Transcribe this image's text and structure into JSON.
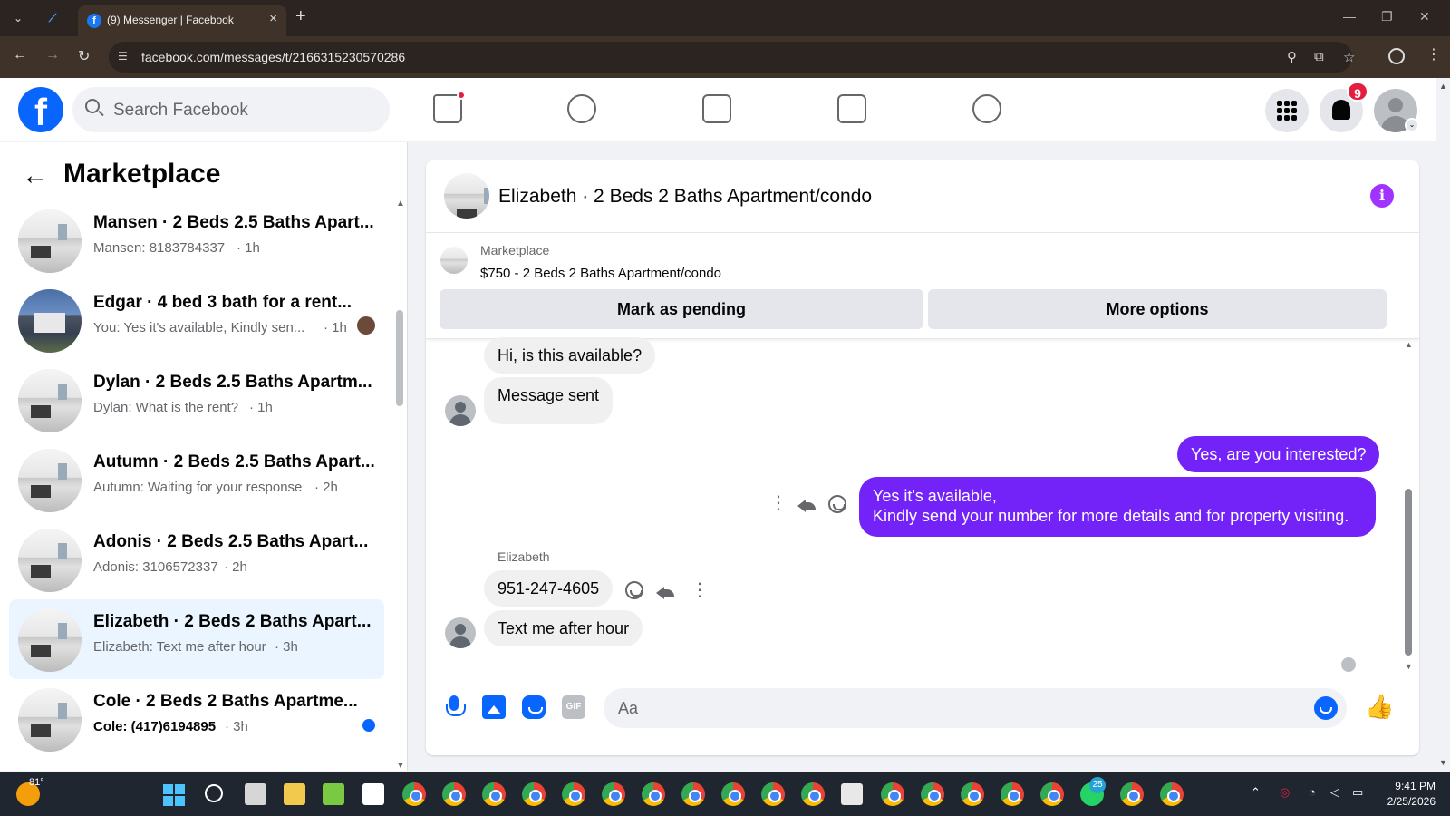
{
  "browser": {
    "tab_title": "(9) Messenger | Facebook",
    "url": "facebook.com/messages/t/2166315230570286"
  },
  "header": {
    "search_placeholder": "Search Facebook",
    "notifications_count": "9",
    "nav_icons": [
      "home-icon",
      "friends-icon",
      "video-icon",
      "marketplace-icon",
      "groups-icon"
    ]
  },
  "sidebar": {
    "title": "Marketplace",
    "conversations": [
      {
        "name": "Mansen · 2 Beds 2.5 Baths Apart...",
        "preview": "Mansen: 8183784337",
        "time": "· 1h"
      },
      {
        "name": "Edgar · 4 bed 3 bath for a rent...",
        "preview": "You: Yes it's available, Kindly sen...",
        "time": "· 1h"
      },
      {
        "name": "Dylan · 2 Beds 2.5 Baths Apartm...",
        "preview": "Dylan: What is the rent?",
        "time": "· 1h"
      },
      {
        "name": "Autumn · 2 Beds 2.5 Baths Apart...",
        "preview": "Autumn: Waiting for your response",
        "time": "· 2h"
      },
      {
        "name": "Adonis · 2 Beds 2.5 Baths Apart...",
        "preview": "Adonis: 3106572337",
        "time": "· 2h"
      },
      {
        "name": "Elizabeth · 2 Beds 2 Baths Apart...",
        "preview": "Elizabeth: Text me after hour",
        "time": "· 3h"
      },
      {
        "name": "Cole · 2 Beds 2 Baths Apartme...",
        "preview": "Cole: (417)6194895",
        "time": "· 3h"
      }
    ]
  },
  "chat": {
    "title": "Elizabeth · 2 Beds 2 Baths Apartment/condo",
    "listing_label": "Marketplace",
    "listing_item": "$750 - 2 Beds 2 Baths Apartment/condo",
    "mark_pending": "Mark as pending",
    "more_options": "More options",
    "messages": [
      {
        "from": "in",
        "text": "Hi, is this available?"
      },
      {
        "from": "in",
        "text": "Message sent"
      },
      {
        "from": "out",
        "text": "Yes, are you interested?"
      },
      {
        "from": "out",
        "line1": "Yes it's available,",
        "line2": "Kindly send your number for more details and for property visiting."
      },
      {
        "from": "in",
        "sender": "Elizabeth",
        "text": "951-247-4605"
      },
      {
        "from": "in",
        "text": "Text me after hour"
      }
    ],
    "composer_placeholder": "Aa",
    "accent_color": "#7323f8"
  },
  "taskbar": {
    "temperature": "81°",
    "whatsapp_badge": "25",
    "time": "9:41 PM",
    "date": "2/25/2026"
  }
}
